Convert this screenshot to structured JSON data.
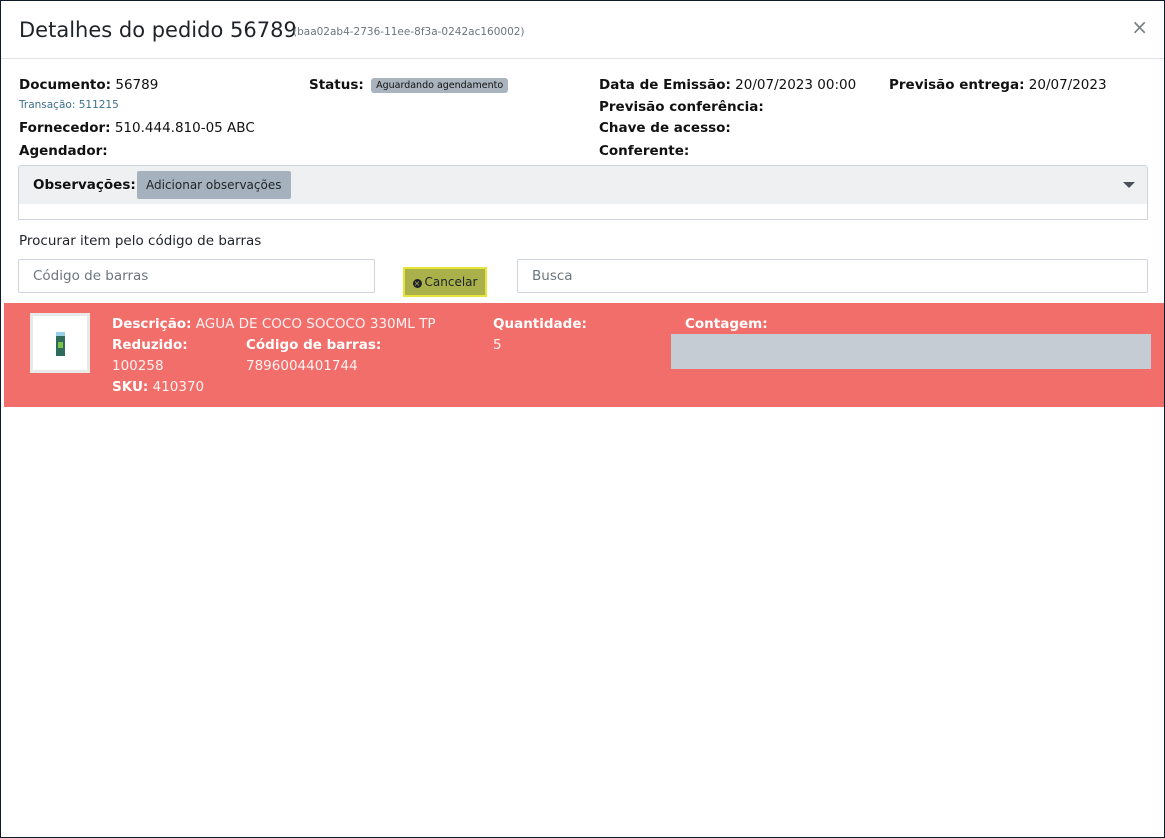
{
  "modal": {
    "title": "Detalhes do pedido 56789",
    "uuid": "(baa02ab4-2736-11ee-8f3a-0242ac160002)",
    "close_glyph": "×"
  },
  "info": {
    "documento_label": "Documento:",
    "documento_value": "56789",
    "transacao_label": "Transação:",
    "transacao_value": "511215",
    "fornecedor_label": "Fornecedor:",
    "fornecedor_value": "510.444.810-05 ABC",
    "agendador_label": "Agendador:",
    "agendador_value": "",
    "status_label": "Status:",
    "status_badge": "Aguardando agendamento",
    "emissao_label": "Data de Emissão:",
    "emissao_value": "20/07/2023 00:00",
    "prev_conf_label": "Previsão conferência:",
    "prev_conf_value": "",
    "chave_label": "Chave de acesso:",
    "chave_value": "",
    "conferente_label": "Conferente:",
    "conferente_value": "",
    "prev_entrega_label": "Previsão entrega:",
    "prev_entrega_value": "20/07/2023"
  },
  "observacoes": {
    "label": "Observações:",
    "button": "Adicionar observações"
  },
  "search": {
    "label": "Procurar item pelo código de barras",
    "barcode_placeholder": "Código de barras",
    "cancel_label": "Cancelar",
    "busca_placeholder": "Busca"
  },
  "item": {
    "descricao_label": "Descrição:",
    "descricao_value": "AGUA DE COCO SOCOCO 330ML TP",
    "reduzido_label": "Reduzido:",
    "reduzido_value": "100258",
    "codigo_label": "Código de barras:",
    "codigo_value": "7896004401744",
    "sku_label": "SKU:",
    "sku_value": "410370",
    "quantidade_label": "Quantidade:",
    "quantidade_value": "5",
    "contagem_label": "Contagem:",
    "row_color": "#f26e6b"
  },
  "colors": {
    "badge": "#aab4be",
    "cancel_button": "#aab14a",
    "cancel_border": "#e4e43a"
  }
}
